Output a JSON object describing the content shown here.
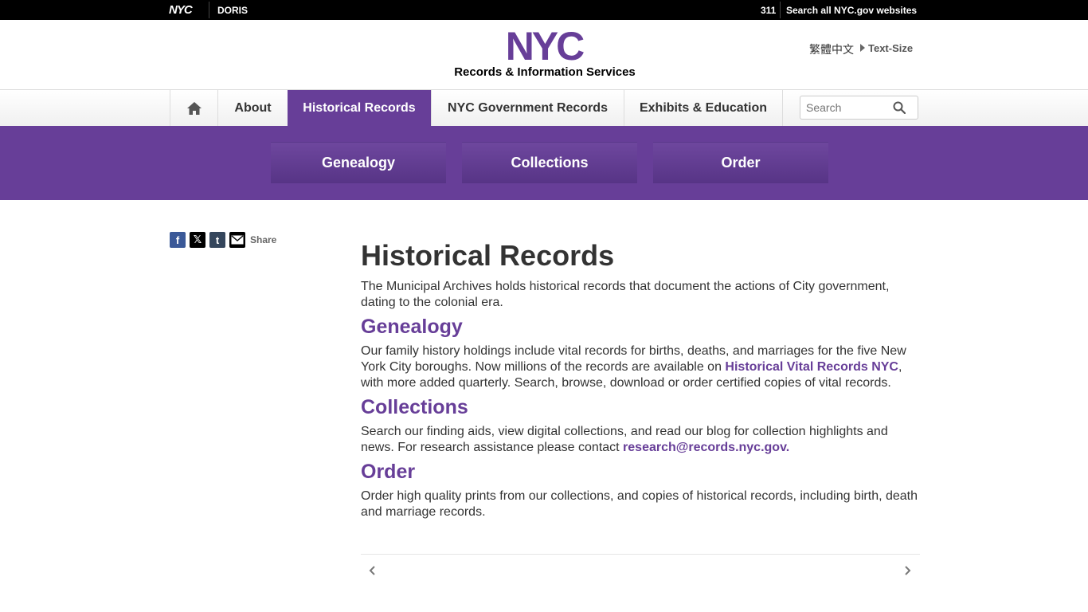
{
  "topbar": {
    "nyc": "NYC",
    "agency": "DORIS",
    "link_311": "311",
    "search_all": "Search all NYC.gov websites"
  },
  "header": {
    "logo_text": "NYC",
    "subtitle": "Records & Information Services",
    "language": "繁體中文",
    "text_size": "Text-Size"
  },
  "nav": {
    "about": "About",
    "historical": "Historical Records",
    "government": "NYC Government Records",
    "exhibits": "Exhibits & Education",
    "search_placeholder": "Search"
  },
  "subnav": {
    "genealogy": "Genealogy",
    "collections": "Collections",
    "order": "Order"
  },
  "share": {
    "label": "Share"
  },
  "content": {
    "title": "Historical Records",
    "intro": "The Municipal Archives holds historical records that document the actions of City government, dating to the colonial era.",
    "genealogy_heading": "Genealogy",
    "genealogy_text_1": "Our family history holdings include vital records for births, deaths, and marriages for the five New York City boroughs. Now millions of the records are available on ",
    "genealogy_link": "Historical Vital Records NYC",
    "genealogy_text_2": ", with more added quarterly. Search, browse, download or order certified copies of vital records.",
    "collections_heading": "Collections",
    "collections_text": "Search our finding aids, view digital collections, and read our blog for collection highlights and news. For research assistance please contact ",
    "collections_link": "research@records.nyc.gov.",
    "order_heading": "Order",
    "order_text": "Order high quality prints from our collections, and copies of historical records, including birth, death and marriage records."
  },
  "colors": {
    "brand_purple": "#673e98",
    "topbar": "#000000"
  }
}
